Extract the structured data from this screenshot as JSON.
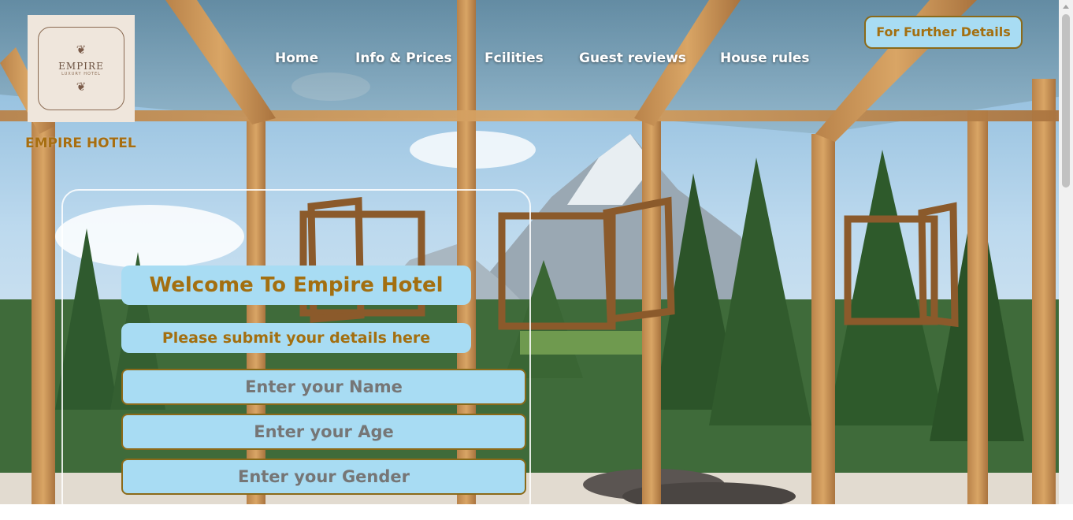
{
  "logo": {
    "name": "EMPIRE",
    "tagline": "LUXURY HOTEL",
    "ornament_icon": "flourish-icon"
  },
  "site_title": "EMPIRE HOTEL",
  "nav": [
    {
      "label": "Home"
    },
    {
      "label": "Info & Prices"
    },
    {
      "label": "Fcilities"
    },
    {
      "label": "Guest reviews"
    },
    {
      "label": "House rules"
    }
  ],
  "details_button": {
    "label": "For Further Details"
  },
  "form": {
    "heading": "Welcome To Empire Hotel",
    "subheading": "Please submit your details here",
    "name_placeholder": "Enter your Name",
    "age_placeholder": "Enter your Age",
    "gender_placeholder": "Enter your Gender"
  },
  "colors": {
    "accent_text": "#a36f10",
    "pill_bg": "#a8dcf3",
    "border": "#8b6a19",
    "logo_bg": "#efe6dc"
  }
}
